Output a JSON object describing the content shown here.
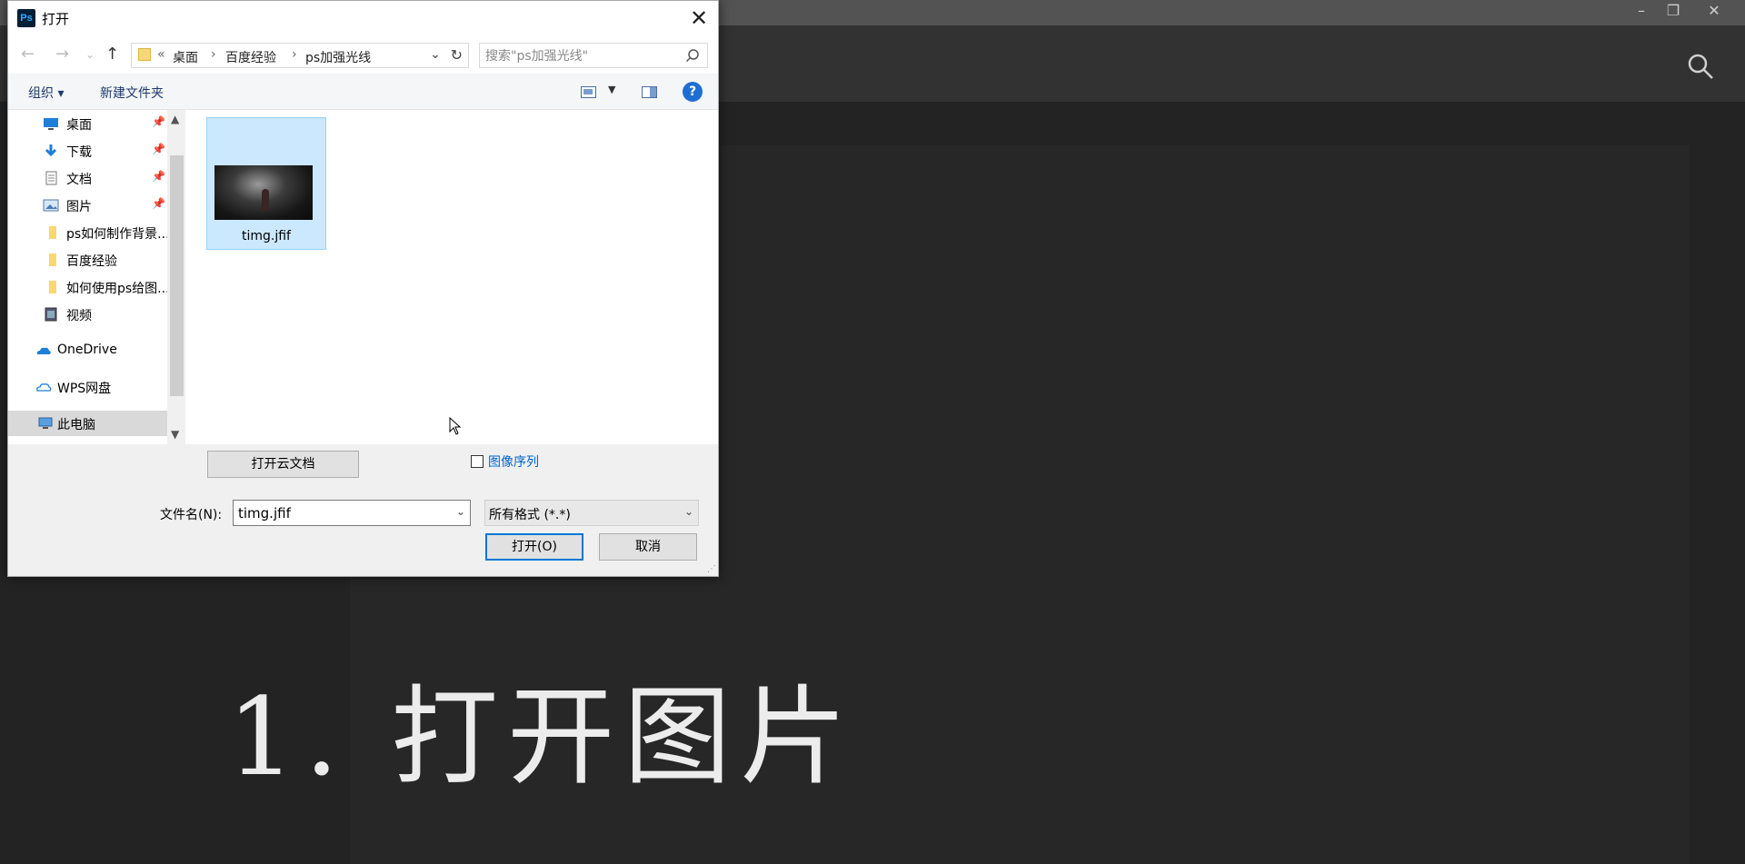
{
  "dialog": {
    "title": "打开",
    "close_glyph": "✕",
    "address": [
      "桌面",
      "百度经验",
      "ps加强光线"
    ],
    "address_prefix": "«",
    "search_placeholder": "搜索\"ps加强光线\"",
    "toolbar": {
      "organize": "组织 ▾",
      "new_folder": "新建文件夹",
      "help": "?"
    },
    "nav_items": [
      {
        "label": "桌面",
        "icon": "desktop-icon",
        "pinned": true
      },
      {
        "label": "下载",
        "icon": "download-icon",
        "pinned": true
      },
      {
        "label": "文档",
        "icon": "documents-icon",
        "pinned": true
      },
      {
        "label": "图片",
        "icon": "pictures-icon",
        "pinned": true
      },
      {
        "label": "ps如何制作背景...",
        "icon": "folder-icon",
        "pinned": false
      },
      {
        "label": "百度经验",
        "icon": "folder-icon",
        "pinned": false
      },
      {
        "label": "如何使用ps给图...",
        "icon": "folder-icon",
        "pinned": false
      },
      {
        "label": "视频",
        "icon": "videos-icon",
        "pinned": false
      },
      {
        "label": "OneDrive",
        "icon": "onedrive-icon",
        "pinned": false
      },
      {
        "label": "WPS网盘",
        "icon": "cloud-icon",
        "pinned": false
      },
      {
        "label": "此电脑",
        "icon": "computer-icon",
        "pinned": false,
        "selected": true
      }
    ],
    "files": [
      {
        "name": "timg.jfif",
        "selected": true
      }
    ],
    "open_cloud_label": "打开云文档",
    "image_sequence_label": "图像序列",
    "image_sequence_checked": false,
    "filename_label": "文件名(N):",
    "filename_value": "timg.jfif",
    "filter_value": "所有格式 (*.*)",
    "open_label": "打开(O)",
    "cancel_label": "取消"
  },
  "photoshop": {
    "caption": "1. 打开图片",
    "window_controls": [
      "–",
      "❐",
      "✕"
    ]
  }
}
